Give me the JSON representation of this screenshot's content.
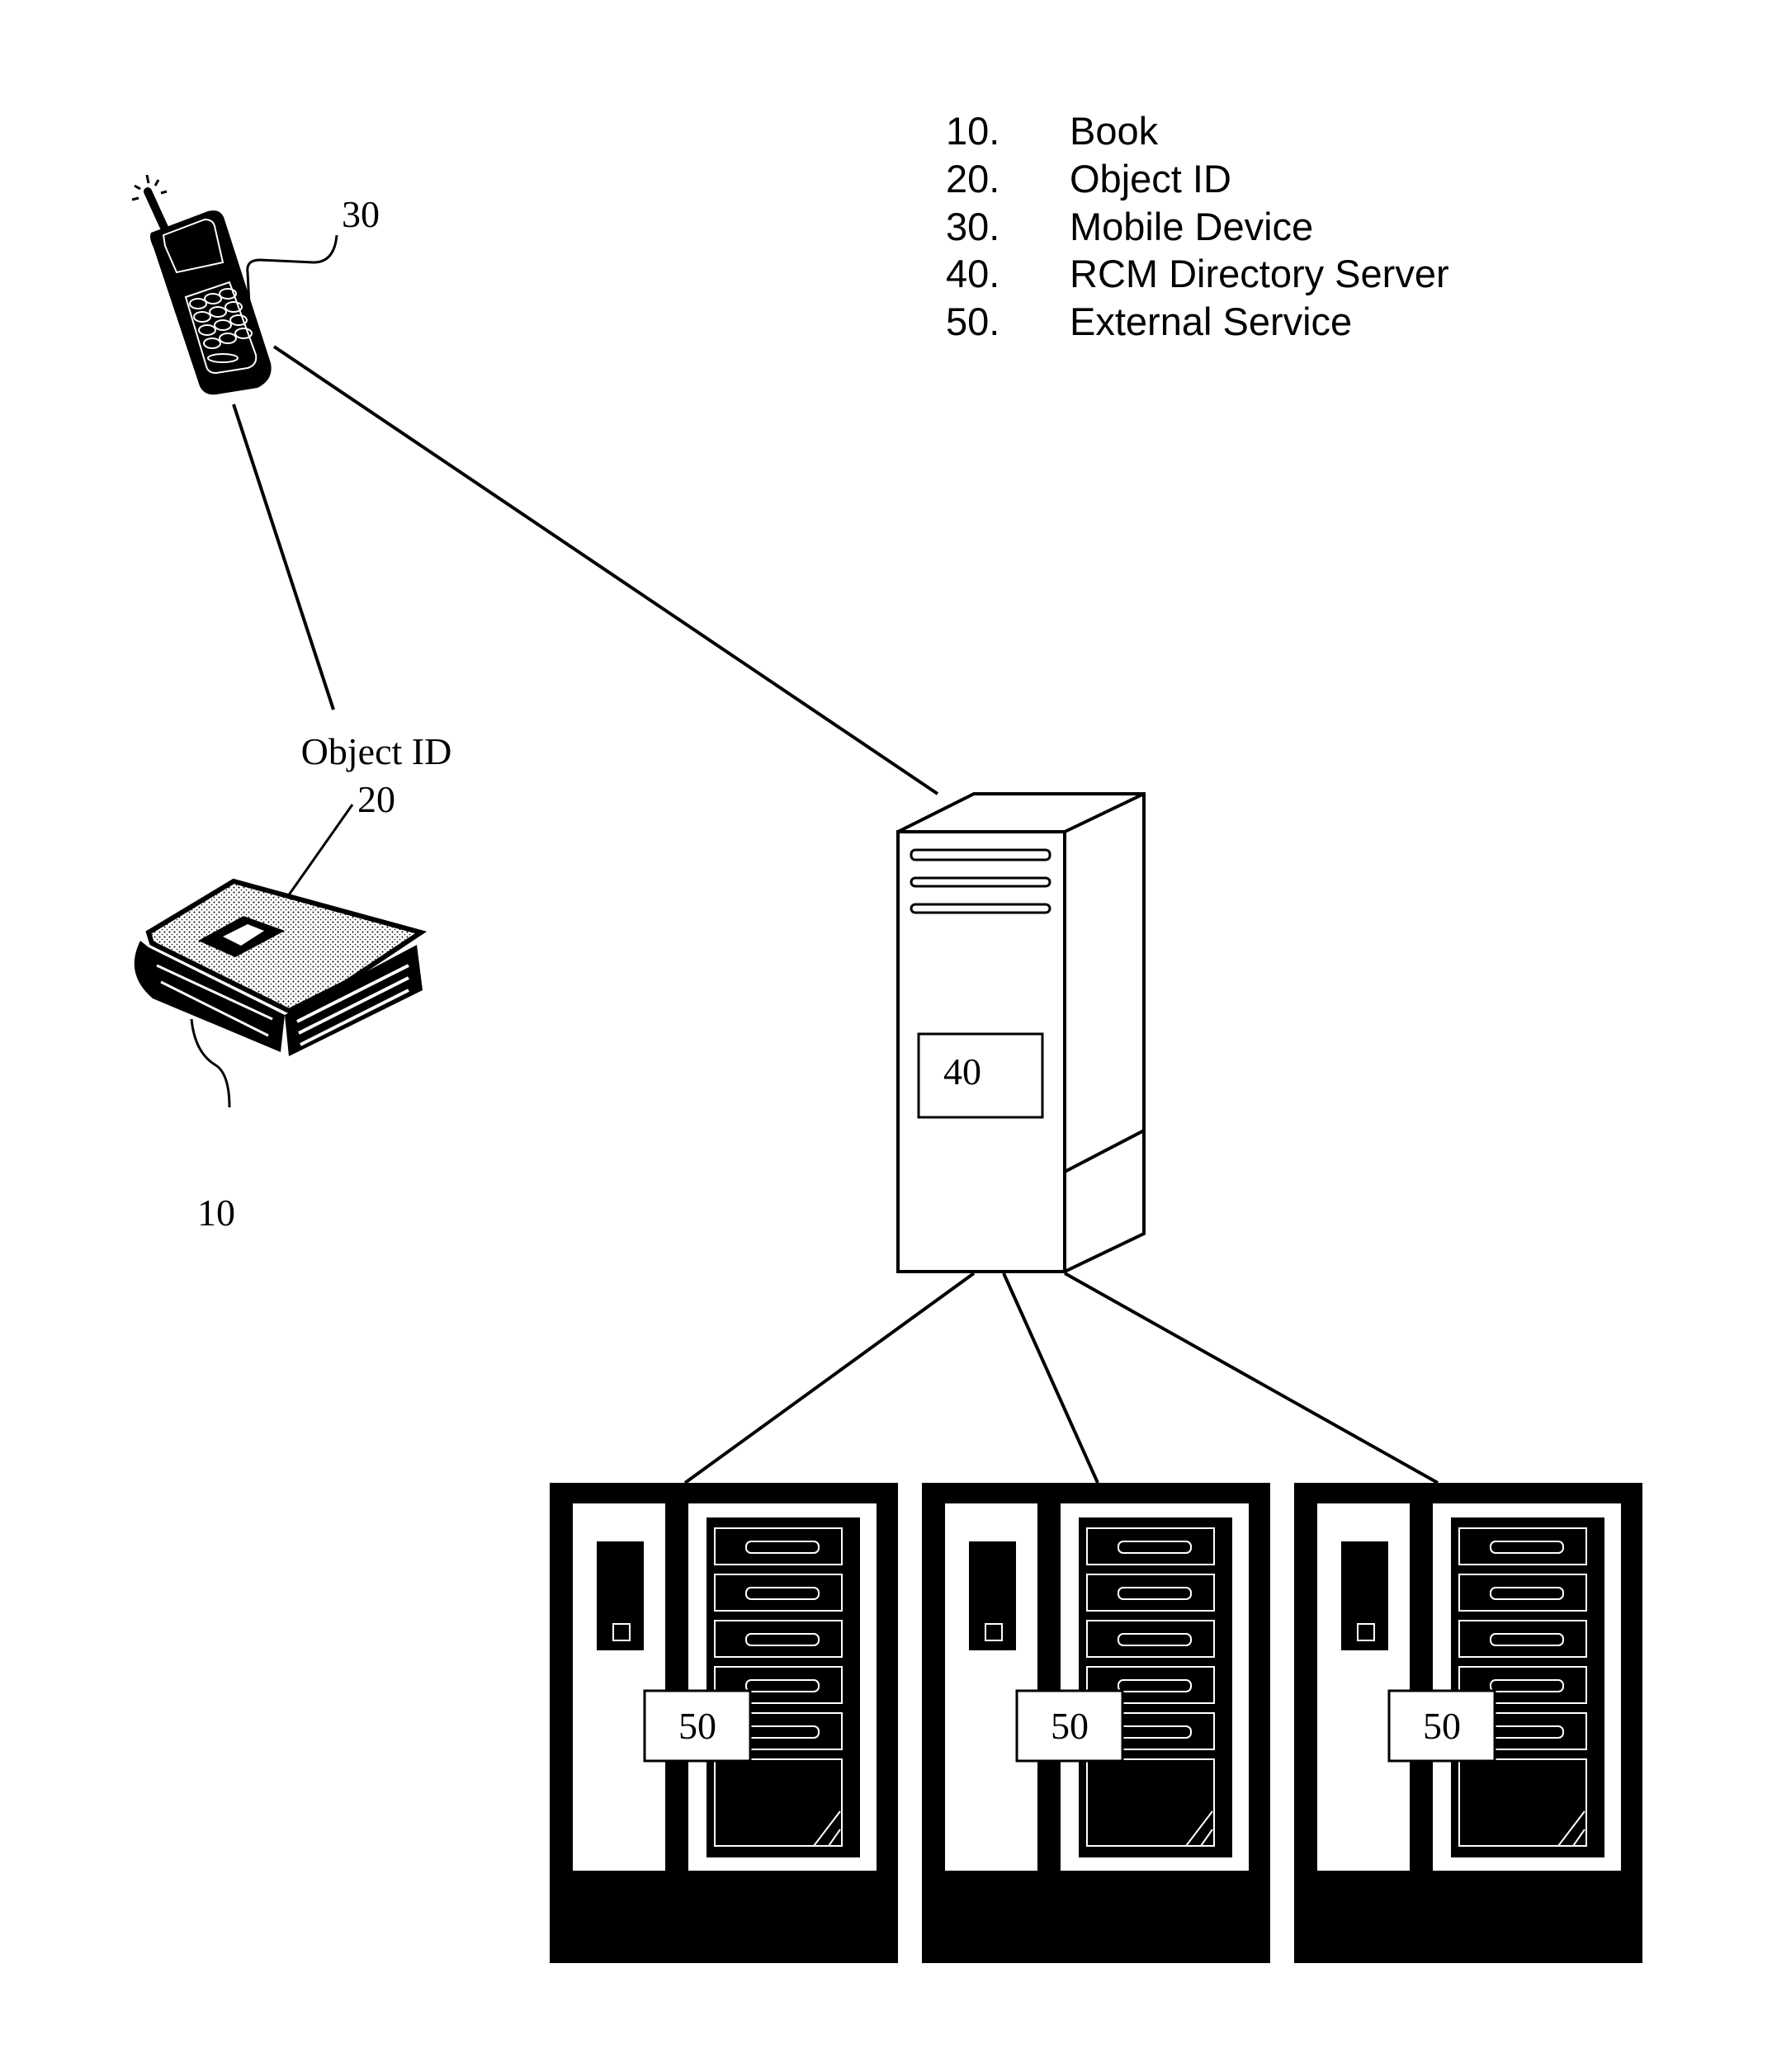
{
  "legend": [
    {
      "num": "10.",
      "label": "Book"
    },
    {
      "num": "20.",
      "label": "Object ID"
    },
    {
      "num": "30.",
      "label": "Mobile Device"
    },
    {
      "num": "40.",
      "label": "RCM Directory Server"
    },
    {
      "num": "50.",
      "label": "External Service"
    }
  ],
  "labels": {
    "mobile_device_ref": "30",
    "object_id_text": "Object ID",
    "object_id_ref": "20",
    "book_ref": "10",
    "directory_server_ref": "40",
    "external_service_refs": [
      "50",
      "50",
      "50"
    ]
  },
  "icons": {
    "mobile_device": "mobile-phone-icon",
    "book": "book-icon",
    "directory_server": "tower-server-icon",
    "external_service": "rack-server-icon"
  }
}
